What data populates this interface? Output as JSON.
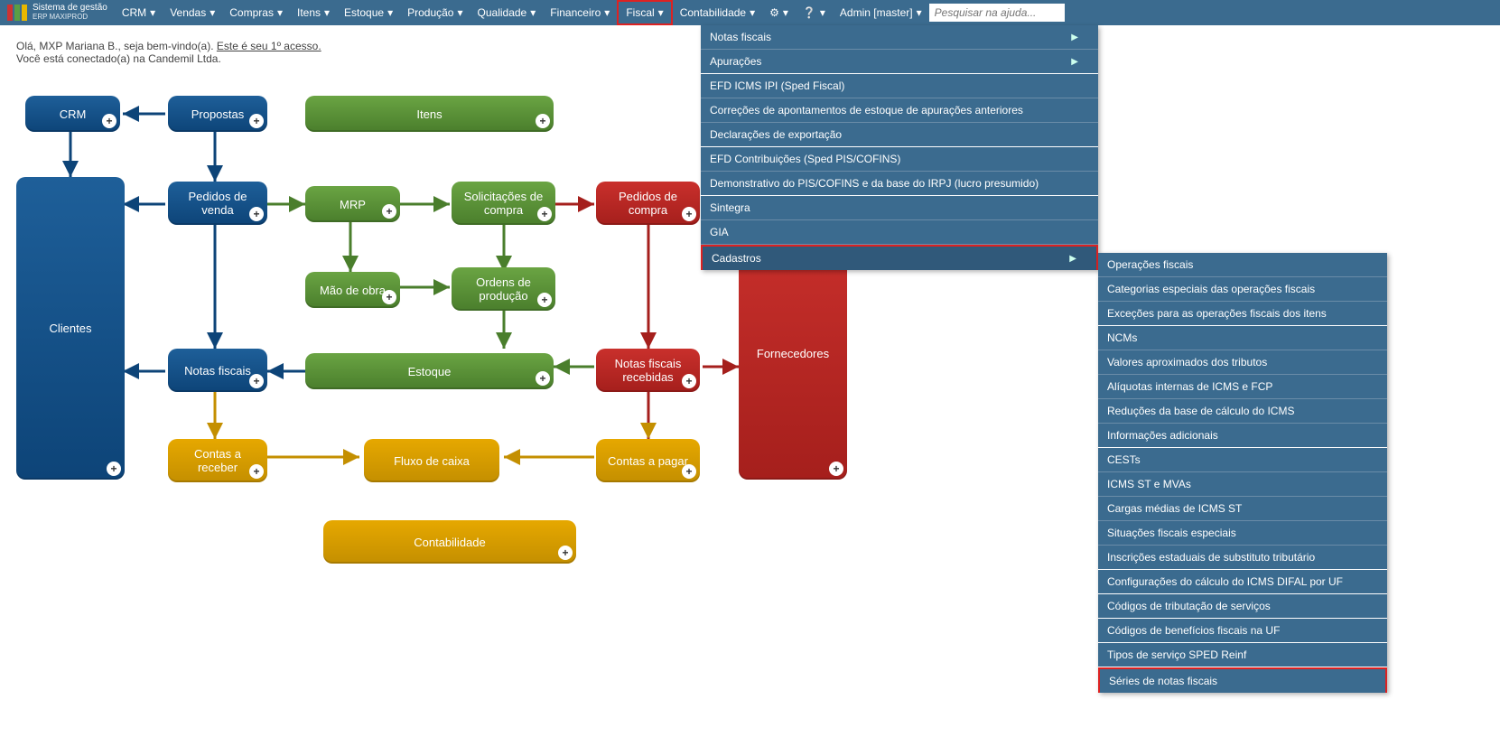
{
  "logo": {
    "line1": "Sistema de gestão",
    "line2": "ERP MAXIPROD"
  },
  "topmenu": [
    "CRM",
    "Vendas",
    "Compras",
    "Itens",
    "Estoque",
    "Produção",
    "Qualidade",
    "Financeiro",
    "Fiscal",
    "Contabilidade"
  ],
  "admin_label": "Admin [master]",
  "search_placeholder": "Pesquisar na ajuda...",
  "welcome": {
    "line1_prefix": "Olá, MXP Mariana B., seja bem-vindo(a). ",
    "line1_link": "Este é seu 1º acesso.",
    "line2": "Você está conectado(a) na Candemil Ltda."
  },
  "fiscal_menu": [
    {
      "label": "Notas fiscais",
      "submenu": true,
      "group_end": false
    },
    {
      "label": "Apurações",
      "submenu": true,
      "group_end": true
    },
    {
      "label": "EFD ICMS IPI (Sped Fiscal)",
      "submenu": false,
      "group_end": false
    },
    {
      "label": "Correções de apontamentos de estoque de apurações anteriores",
      "submenu": false,
      "group_end": false
    },
    {
      "label": "Declarações de exportação",
      "submenu": false,
      "group_end": true
    },
    {
      "label": "EFD Contribuições (Sped PIS/COFINS)",
      "submenu": false,
      "group_end": false
    },
    {
      "label": "Demonstrativo do PIS/COFINS e da base do IRPJ (lucro presumido)",
      "submenu": false,
      "group_end": true
    },
    {
      "label": "Sintegra",
      "submenu": false,
      "group_end": false
    },
    {
      "label": "GIA",
      "submenu": false,
      "group_end": false
    },
    {
      "label": "Cadastros",
      "submenu": true,
      "group_end": false,
      "highlighted": true
    }
  ],
  "cadastros_menu": [
    {
      "label": "Operações fiscais",
      "group_end": false
    },
    {
      "label": "Categorias especiais das operações fiscais",
      "group_end": false
    },
    {
      "label": "Exceções para as operações fiscais dos itens",
      "group_end": true
    },
    {
      "label": "NCMs",
      "group_end": false
    },
    {
      "label": "Valores aproximados dos tributos",
      "group_end": false
    },
    {
      "label": "Alíquotas internas de ICMS e FCP",
      "group_end": false
    },
    {
      "label": "Reduções da base de cálculo do ICMS",
      "group_end": false
    },
    {
      "label": "Informações adicionais",
      "group_end": true
    },
    {
      "label": "CESTs",
      "group_end": false
    },
    {
      "label": "ICMS ST e MVAs",
      "group_end": false
    },
    {
      "label": "Cargas médias de ICMS ST",
      "group_end": false
    },
    {
      "label": "Situações fiscais especiais",
      "group_end": false
    },
    {
      "label": "Inscrições estaduais de substituto tributário",
      "group_end": true
    },
    {
      "label": "Configurações do cálculo do ICMS DIFAL por UF",
      "group_end": true
    },
    {
      "label": "Códigos de tributação de serviços",
      "group_end": true
    },
    {
      "label": "Códigos de benefícios fiscais na UF",
      "group_end": true
    },
    {
      "label": "Tipos de serviço SPED Reinf",
      "group_end": true
    },
    {
      "label": "Séries de notas fiscais",
      "group_end": false,
      "highlighted": true
    }
  ],
  "nodes": {
    "crm": "CRM",
    "propostas": "Propostas",
    "itens": "Itens",
    "pedidos_venda": "Pedidos de venda",
    "mrp": "MRP",
    "solicitacoes_compra": "Solicitações de compra",
    "pedidos_compra": "Pedidos de compra",
    "mao_obra": "Mão de obra",
    "ordens_producao": "Ordens de produção",
    "clientes": "Clientes",
    "notas_fiscais": "Notas fiscais",
    "estoque": "Estoque",
    "nf_recebidas": "Notas fiscais recebidas",
    "fornecedores": "Fornecedores",
    "contas_receber": "Contas a receber",
    "fluxo_caixa": "Fluxo de caixa",
    "contas_pagar": "Contas a pagar",
    "contabilidade": "Contabilidade"
  }
}
